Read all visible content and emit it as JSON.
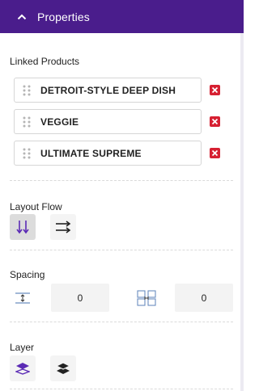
{
  "header": {
    "title": "Properties",
    "collapse_icon": "chevron-up-icon"
  },
  "linked_products": {
    "title": "Linked Products",
    "items": [
      {
        "name": "DETROIT-STYLE DEEP DISH"
      },
      {
        "name": "VEGGIE"
      },
      {
        "name": "ULTIMATE SUPREME"
      }
    ]
  },
  "layout_flow": {
    "title": "Layout Flow",
    "options": [
      {
        "icon": "vertical-flow-icon",
        "selected": true
      },
      {
        "icon": "horizontal-flow-icon",
        "selected": false
      }
    ]
  },
  "spacing": {
    "title": "Spacing",
    "vertical_value": "0",
    "horizontal_value": "0"
  },
  "layer": {
    "title": "Layer",
    "options": [
      {
        "icon": "bring-forward-icon"
      },
      {
        "icon": "send-backward-icon"
      }
    ]
  },
  "colors": {
    "header_bg": "#4a1d8c",
    "accent": "#5b2bb5",
    "remove": "#d62032"
  }
}
